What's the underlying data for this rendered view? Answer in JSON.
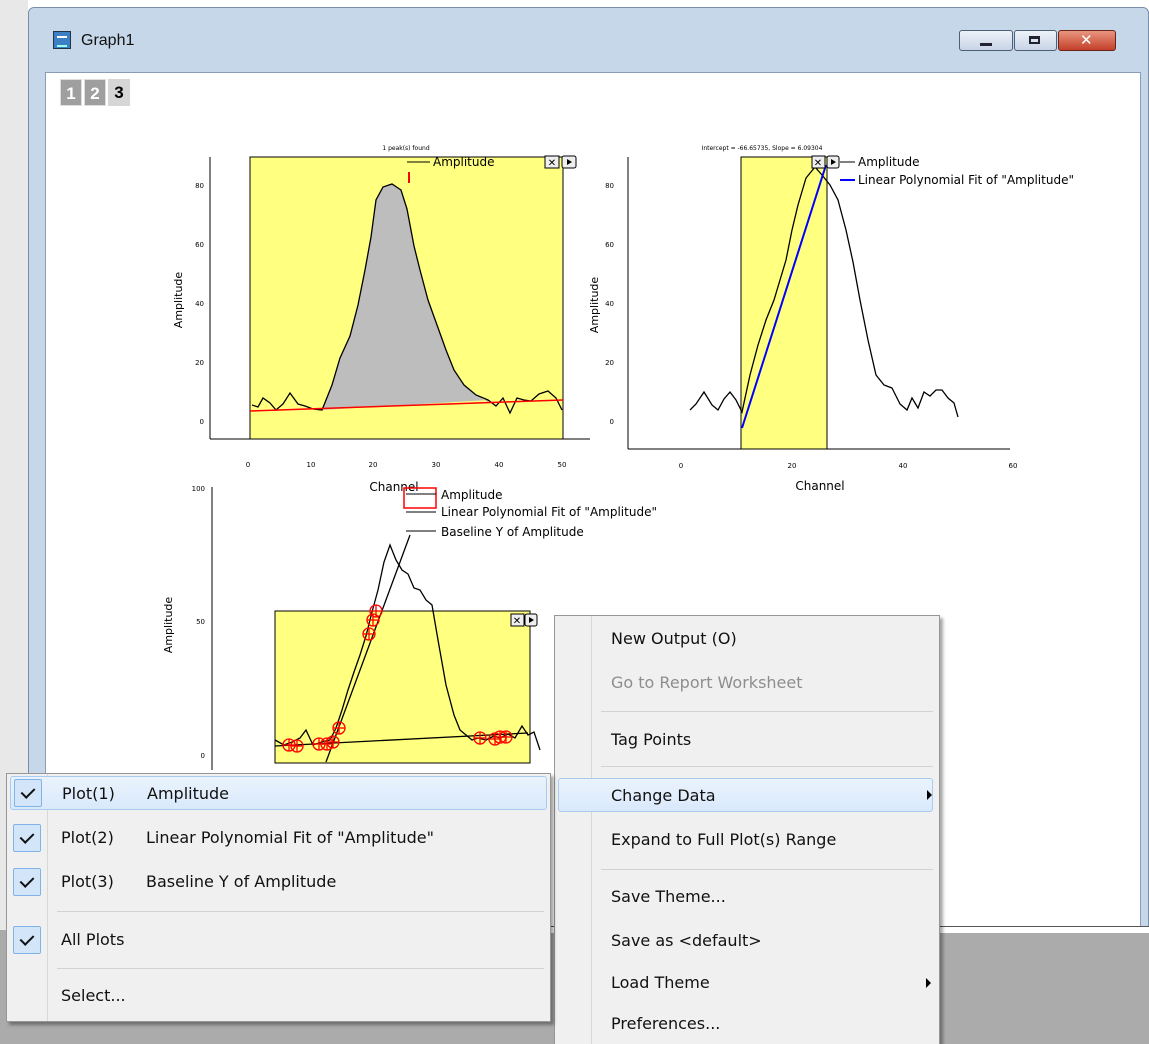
{
  "window": {
    "title": "Graph1"
  },
  "layer_tabs": [
    "1",
    "2",
    "3"
  ],
  "active_layer_tab": "3",
  "graphs": [
    {
      "header": "1 peak(s) found",
      "legend": [
        "Amplitude"
      ],
      "ylabel": "Amplitude",
      "xlabel": "Channel",
      "xticks": [
        "0",
        "10",
        "20",
        "30",
        "40",
        "50"
      ],
      "yticks": [
        "0",
        "20",
        "40",
        "60",
        "80"
      ]
    },
    {
      "header": "Intercept = -66.65735, Slope = 6.09304",
      "legend": [
        "Amplitude",
        "Linear Polynomial Fit of \"Amplitude\""
      ],
      "ylabel": "Amplitude",
      "xlabel": "Channel",
      "xticks": [
        "0",
        "20",
        "40",
        "60"
      ],
      "yticks": [
        "0",
        "20",
        "40",
        "60",
        "80"
      ]
    },
    {
      "header": "",
      "legend": [
        "Amplitude",
        "Linear Polynomial Fit of \"Amplitude\"",
        "Baseline Y of Amplitude"
      ],
      "ylabel": "Amplitude",
      "xlabel": "",
      "xticks": [],
      "yticks": [
        "0",
        "50",
        "100"
      ]
    }
  ],
  "context_menu": {
    "items": [
      "New Output (O)",
      "Go to Report Worksheet",
      "Tag Points",
      "Change Data",
      "Expand to Full Plot(s) Range",
      "Save Theme...",
      "Save as <default>",
      "Load Theme",
      "Preferences..."
    ],
    "disabled": [
      "Go to Report Worksheet"
    ],
    "highlighted": "Change Data"
  },
  "submenu": {
    "plots": [
      {
        "tag": "Plot(1)",
        "name": "Amplitude",
        "checked": true
      },
      {
        "tag": "Plot(2)",
        "name": "Linear Polynomial Fit of \"Amplitude\"",
        "checked": true
      },
      {
        "tag": "Plot(3)",
        "name": "Baseline Y of Amplitude",
        "checked": true
      }
    ],
    "all_plots": {
      "label": "All Plots",
      "checked": true
    },
    "select": "Select..."
  },
  "colors": {
    "panel_fill": "#ffff80",
    "peak_fill": "#bdbdbd",
    "baseline": "#ff0000",
    "fit_line": "#0000ff",
    "marker": "#ff0000",
    "highlight": "#d9e9fb"
  }
}
